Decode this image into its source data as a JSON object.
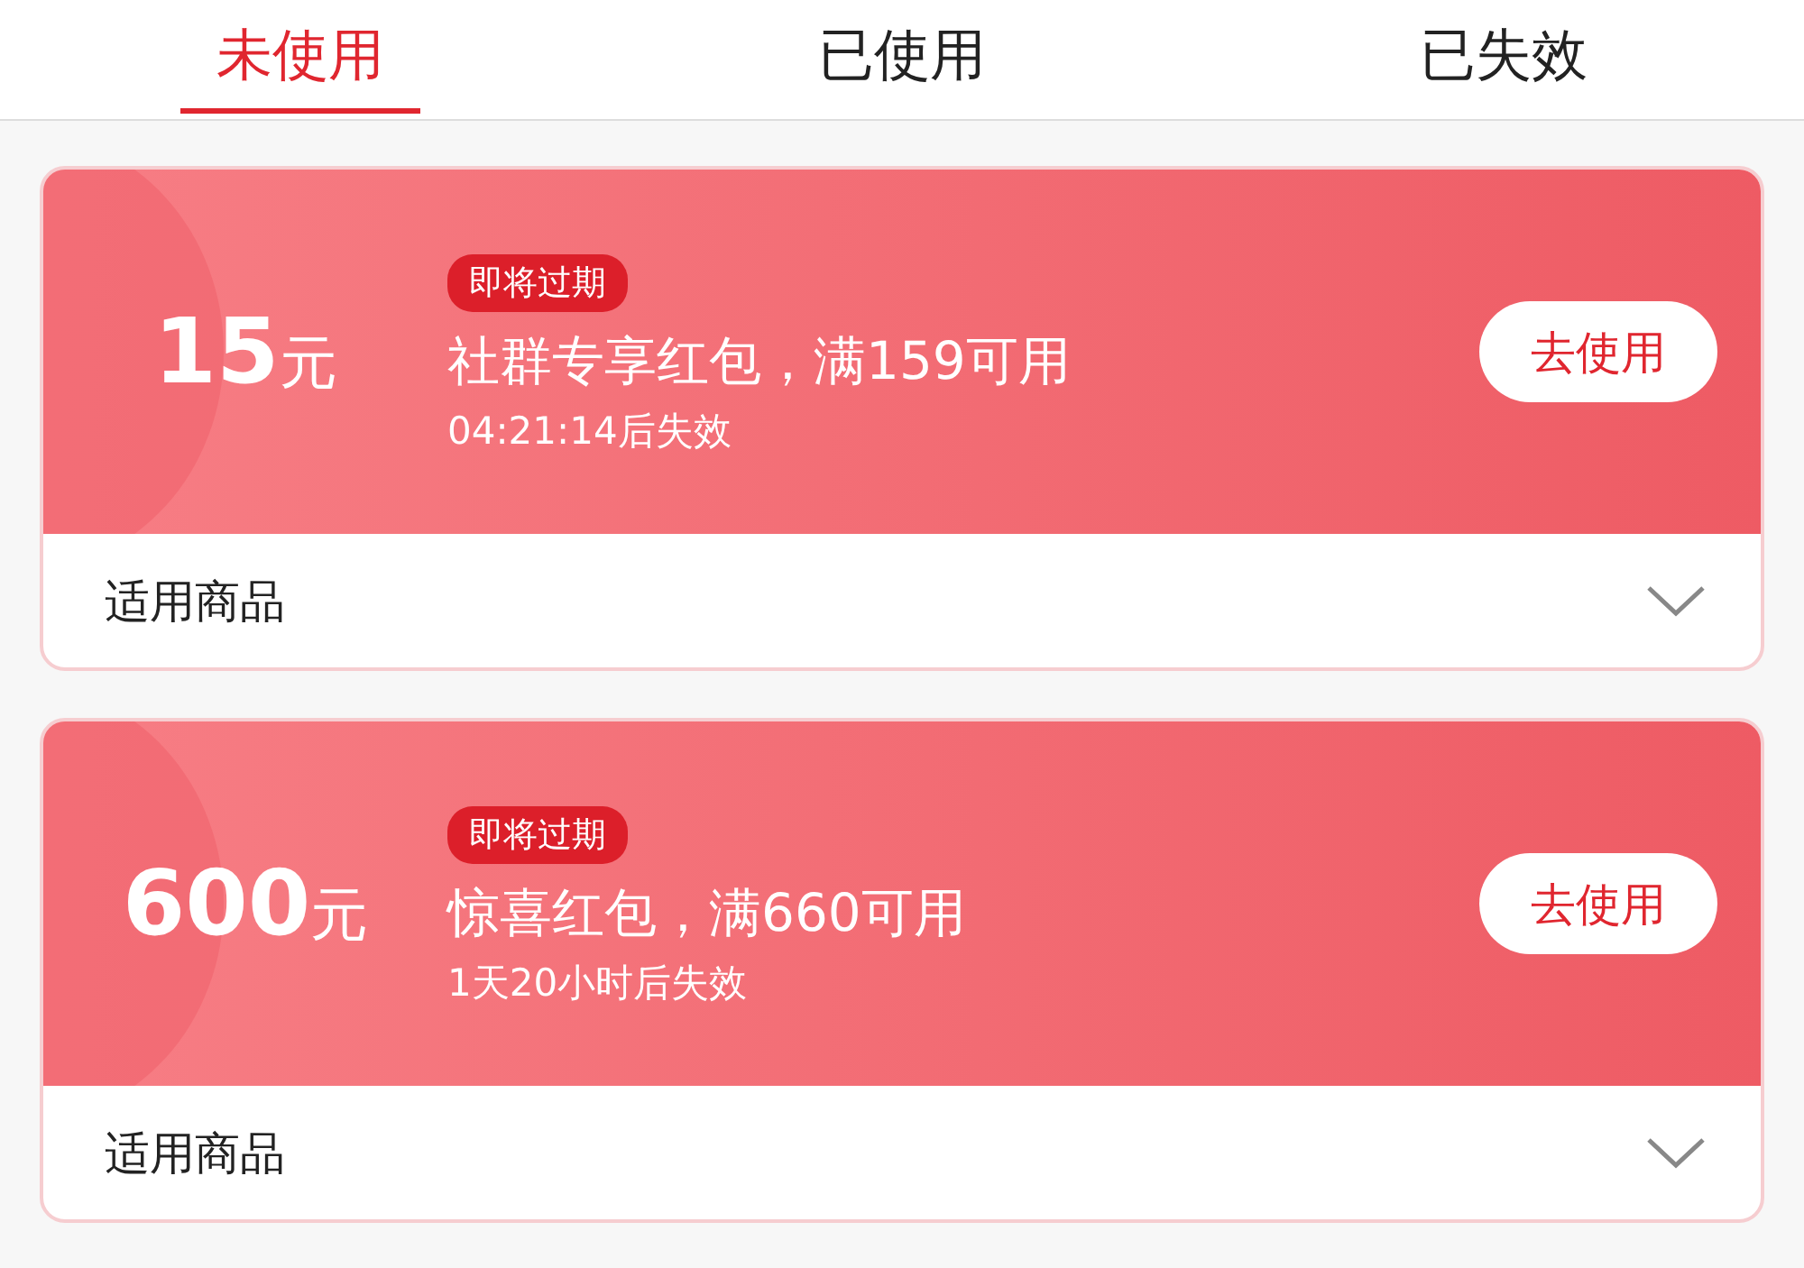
{
  "tabs": [
    {
      "label": "未使用",
      "selected": true
    },
    {
      "label": "已使用",
      "selected": false
    },
    {
      "label": "已失效",
      "selected": false
    }
  ],
  "coupons": [
    {
      "amount": "15",
      "unit": "元",
      "badge": "即将过期",
      "title": "社群专享红包，满159可用",
      "expiry": "04:21:14后失效",
      "button": "去使用",
      "footer": "适用商品"
    },
    {
      "amount": "600",
      "unit": "元",
      "badge": "即将过期",
      "title": "惊喜红包，满660可用",
      "expiry": "1天20小时后失效",
      "button": "去使用",
      "footer": "适用商品"
    }
  ]
}
